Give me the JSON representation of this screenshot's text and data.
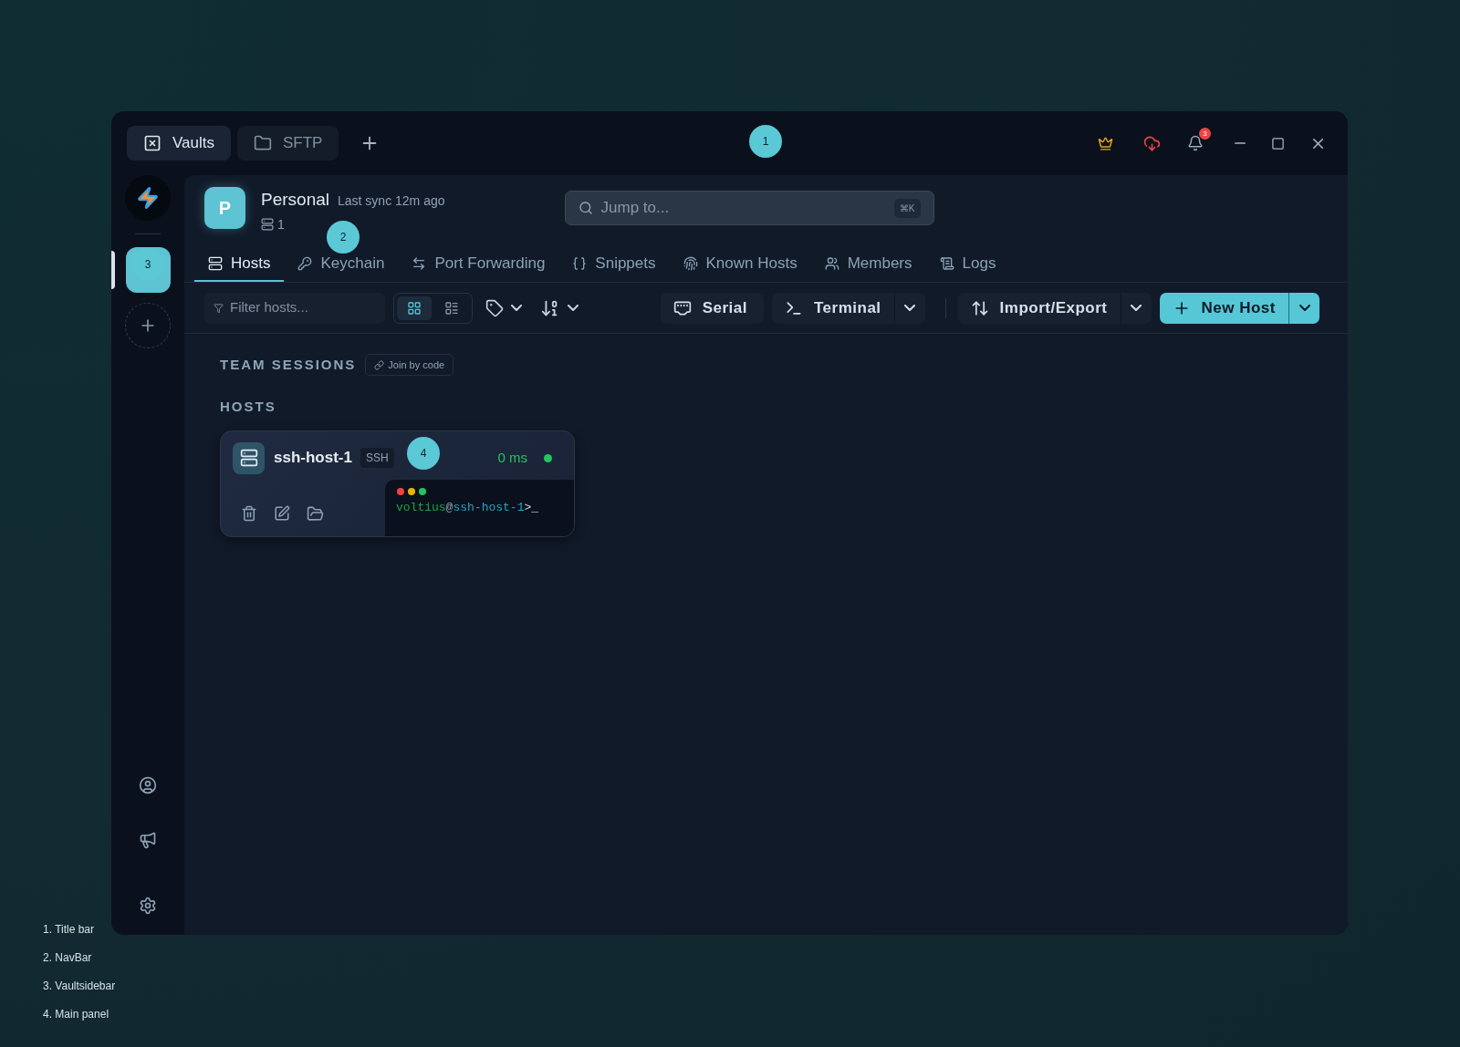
{
  "title_bar": {
    "tabs": [
      {
        "label": "Vaults",
        "kind": "vaults",
        "selected": true
      },
      {
        "label": "SFTP",
        "kind": "sftp",
        "selected": false
      }
    ],
    "notification_count": "3"
  },
  "sidebar": {
    "vaults": [
      {
        "selected": true
      }
    ]
  },
  "vault": {
    "avatar_letter": "P",
    "name": "Personal",
    "sync": "Last sync 12m ago",
    "host_count": "1"
  },
  "search": {
    "placeholder": "Jump to...",
    "shortcut": "⌘K"
  },
  "nav_tabs": [
    {
      "label": "Hosts",
      "kind": "hosts",
      "selected": true
    },
    {
      "label": "Keychain",
      "kind": "keychain",
      "selected": false
    },
    {
      "label": "Port Forwarding",
      "kind": "forwarding",
      "selected": false
    },
    {
      "label": "Snippets",
      "kind": "snippets",
      "selected": false
    },
    {
      "label": "Known Hosts",
      "kind": "known",
      "selected": false
    },
    {
      "label": "Members",
      "kind": "members",
      "selected": false
    },
    {
      "label": "Logs",
      "kind": "logs",
      "selected": false
    }
  ],
  "toolbar": {
    "filter_placeholder": "Filter hosts...",
    "view_modes": [
      {
        "kind": "grid",
        "selected": true
      },
      {
        "kind": "list",
        "selected": false
      }
    ],
    "buttons": [
      {
        "label": "Serial",
        "kind": "serial",
        "split": false,
        "primary": false
      },
      {
        "label": "Terminal",
        "kind": "terminal",
        "split": true,
        "primary": false
      },
      {
        "label": "Import/Export",
        "kind": "import",
        "split": true,
        "primary": false
      },
      {
        "label": "New Host",
        "kind": "new",
        "split": true,
        "primary": true
      }
    ]
  },
  "team_sessions": {
    "title": "TEAM SESSIONS",
    "join_label": "Join by code"
  },
  "hosts_section": {
    "title": "HOSTS",
    "hosts": [
      {
        "name": "ssh-host-1",
        "protocol": "SSH",
        "latency": "0 ms",
        "online": true,
        "prompt": {
          "user": "voltius",
          "separator": "@",
          "host": "ssh-host-1",
          "suffix": ">_"
        }
      }
    ]
  },
  "annotations": {
    "markers": [
      "1",
      "2",
      "3",
      "4"
    ],
    "legend": [
      "1. Title bar",
      "2. NavBar",
      "3. Vaultsidebar",
      "4. Main panel"
    ]
  }
}
